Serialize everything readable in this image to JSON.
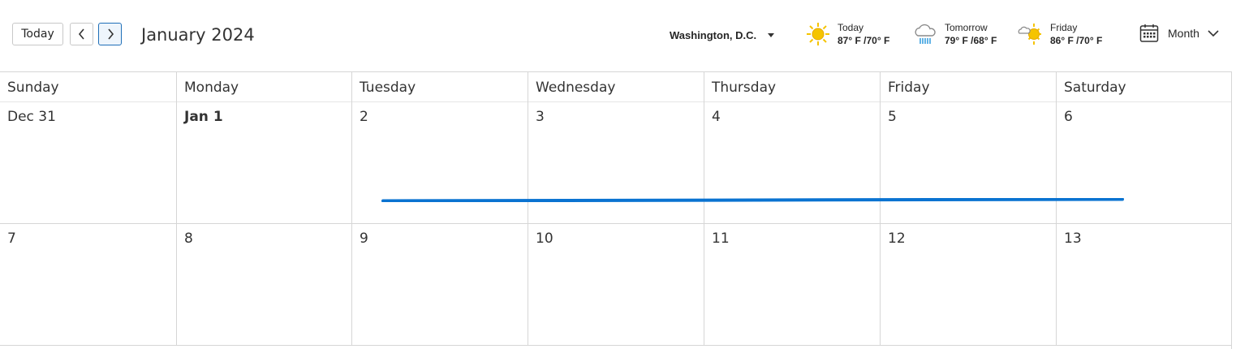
{
  "toolbar": {
    "today_label": "Today",
    "prev_icon": "chevron-left-icon",
    "next_icon": "chevron-right-icon",
    "month_title": "January 2024",
    "location": "Washington,  D.C.",
    "view_label": "Month"
  },
  "weather": [
    {
      "day": "Today",
      "temp": "87° F /70° F",
      "icon": "sun-icon"
    },
    {
      "day": "Tomorrow",
      "temp": "79° F /68° F",
      "icon": "rain-cloud-icon"
    },
    {
      "day": "Friday",
      "temp": "86° F /70° F",
      "icon": "partly-sunny-icon"
    }
  ],
  "calendar": {
    "weekdays": [
      "Sunday",
      "Monday",
      "Tuesday",
      "Wednesday",
      "Thursday",
      "Friday",
      "Saturday"
    ],
    "weeks": [
      [
        "Dec 31",
        "Jan 1",
        "2",
        "3",
        "4",
        "5",
        "6"
      ],
      [
        "7",
        "8",
        "9",
        "10",
        "11",
        "12",
        "13"
      ]
    ]
  },
  "colors": {
    "accent": "#0f6cbd",
    "event_stroke": "#0a73d1",
    "sun": "#f5c400"
  }
}
